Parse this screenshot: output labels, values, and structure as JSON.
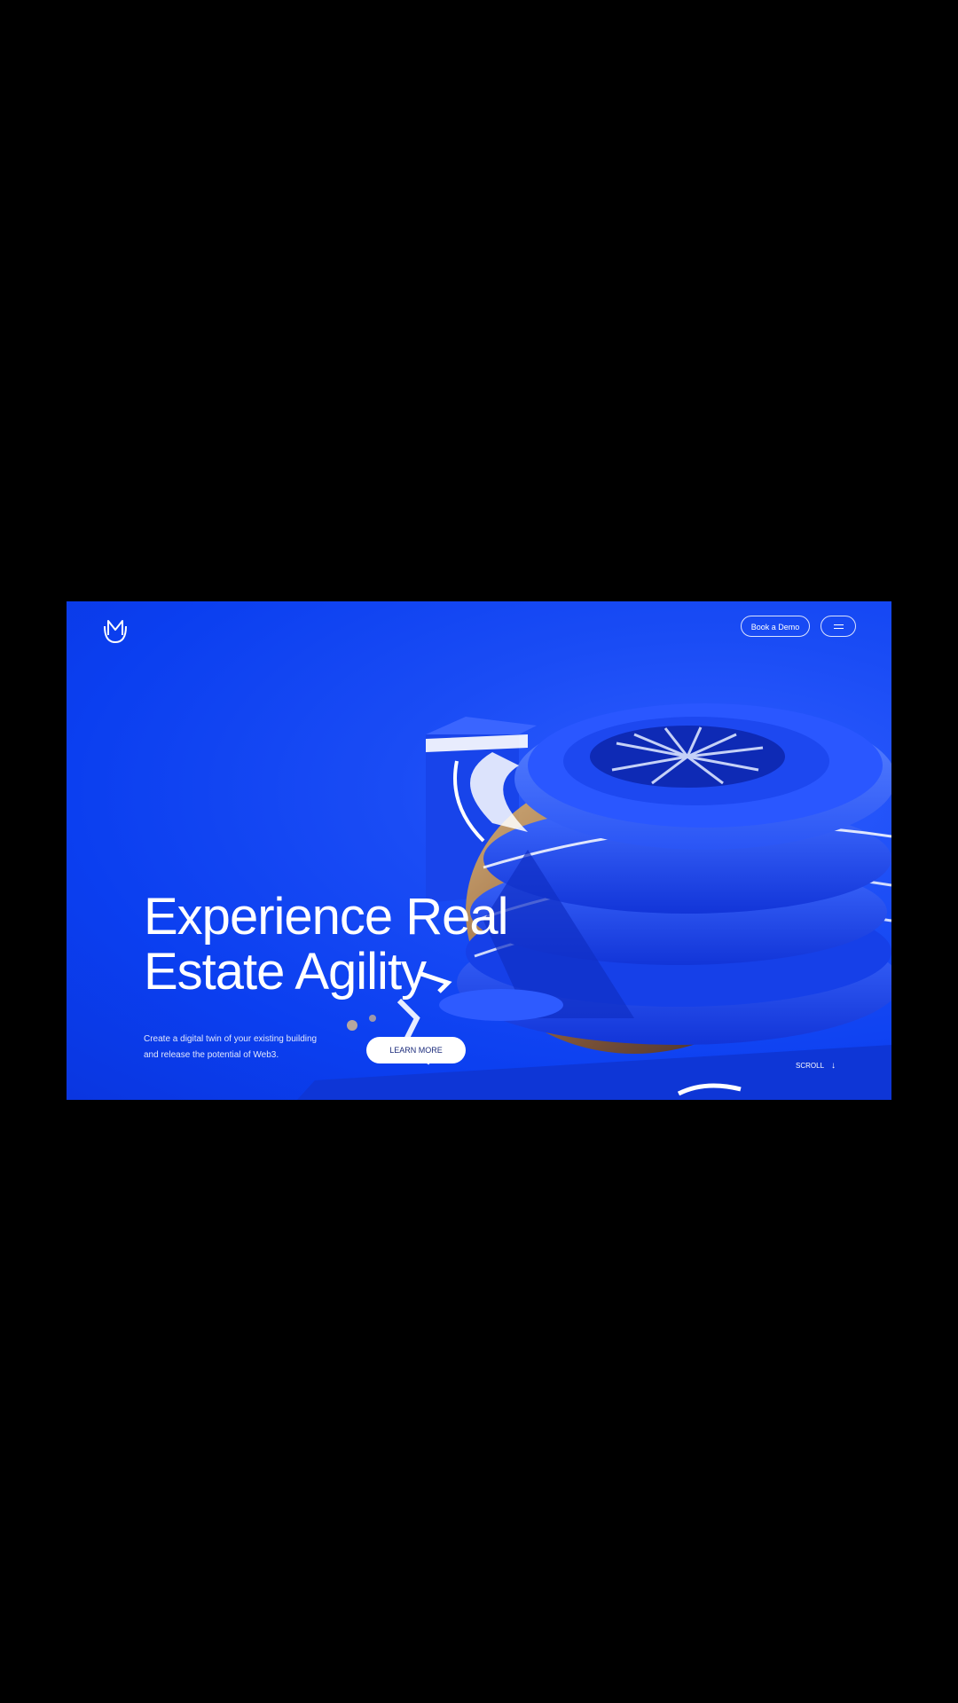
{
  "header": {
    "logo_icon": "crown-m-logo-icon",
    "book_demo_label": "Book a Demo",
    "menu_icon": "hamburger-menu-icon"
  },
  "hero": {
    "headline_line1": "Experience Real",
    "headline_line2": "Estate Agility",
    "subtitle_line1": "Create a digital twin of your existing building",
    "subtitle_line2": "and release the potential of Web3.",
    "cta_label": "LEARN MORE",
    "scroll_label": "SCROLL",
    "scroll_icon": "arrow-down-icon"
  },
  "colors": {
    "page_background": "#000000",
    "hero_blue": "#0b3ff0",
    "text": "#ffffff",
    "cta_text": "#1a2a7a"
  }
}
